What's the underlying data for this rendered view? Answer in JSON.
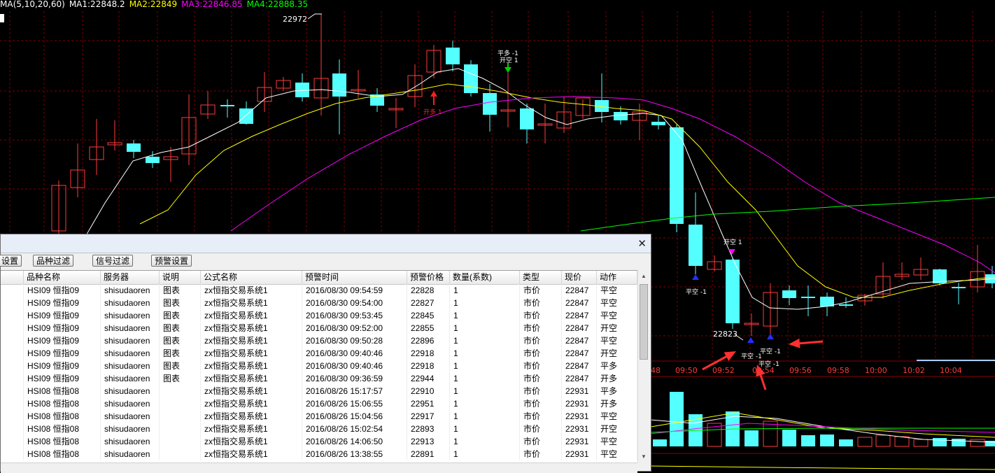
{
  "ma_bar": {
    "label": "MA(5,10,20,60)",
    "ma1": "MA1:22848.2",
    "ma2": "MA2:22849",
    "ma3": "MA3:22846.85",
    "ma4": "MA4:22888.35",
    "colors": {
      "label": "#ffffff",
      "ma1": "#ffffff",
      "ma2": "#ffff00",
      "ma3": "#ff00ff",
      "ma4": "#00ff00"
    }
  },
  "chart_data": {
    "type": "candlestick",
    "high_label": "22972",
    "low_label": "22823",
    "time_labels": [
      "48",
      "09:50",
      "09:52",
      "09:54",
      "09:56",
      "09:58",
      "10:00",
      "10:02",
      "10:04"
    ],
    "signals": [
      {
        "text": "开多 1",
        "color": "#ff2020"
      },
      {
        "text": "平多 -1",
        "color": "#ffffff"
      },
      {
        "text": "开空 1",
        "color": "#ffffff"
      },
      {
        "text": "平空 -1",
        "color": "#ffffff"
      },
      {
        "text": "开空 1",
        "color": "#ffffff"
      },
      {
        "text": "平空 -1",
        "color": "#ffffff"
      },
      {
        "text": "平空 -1",
        "color": "#ffffff"
      },
      {
        "text": "平空 -1",
        "color": "#ffffff"
      }
    ],
    "up_color": "#ff3b3b",
    "down_color": "#54ffff",
    "ma_colors": [
      "#ffffff",
      "#ffff00",
      "#ff00ff",
      "#00ff00"
    ]
  },
  "dialog": {
    "close_icon": "close-icon",
    "toolbar": [
      "设置",
      "品种过滤",
      "信号过滤",
      "预警设置"
    ],
    "columns": [
      "品种名称",
      "服务器",
      "说明",
      "公式名称",
      "预警时间",
      "预警价格",
      "数量(系数)",
      "类型",
      "现价",
      "动作"
    ],
    "rows": [
      [
        "HSI09 恒指09",
        "shisudaoren",
        "图表",
        "zx恒指交易系统1",
        "2016/08/30 09:54:59",
        "22828",
        "1",
        "市价",
        "22847",
        "平空"
      ],
      [
        "HSI09 恒指09",
        "shisudaoren",
        "图表",
        "zx恒指交易系统1",
        "2016/08/30 09:54:00",
        "22827",
        "1",
        "市价",
        "22847",
        "平空"
      ],
      [
        "HSI09 恒指09",
        "shisudaoren",
        "图表",
        "zx恒指交易系统1",
        "2016/08/30 09:53:45",
        "22845",
        "1",
        "市价",
        "22847",
        "平空"
      ],
      [
        "HSI09 恒指09",
        "shisudaoren",
        "图表",
        "zx恒指交易系统1",
        "2016/08/30 09:52:00",
        "22855",
        "1",
        "市价",
        "22847",
        "开空"
      ],
      [
        "HSI09 恒指09",
        "shisudaoren",
        "图表",
        "zx恒指交易系统1",
        "2016/08/30 09:50:28",
        "22896",
        "1",
        "市价",
        "22847",
        "平空"
      ],
      [
        "HSI09 恒指09",
        "shisudaoren",
        "图表",
        "zx恒指交易系统1",
        "2016/08/30 09:40:46",
        "22918",
        "1",
        "市价",
        "22847",
        "开空"
      ],
      [
        "HSI09 恒指09",
        "shisudaoren",
        "图表",
        "zx恒指交易系统1",
        "2016/08/30 09:40:46",
        "22918",
        "1",
        "市价",
        "22847",
        "平多"
      ],
      [
        "HSI09 恒指09",
        "shisudaoren",
        "图表",
        "zx恒指交易系统1",
        "2016/08/30 09:36:59",
        "22944",
        "1",
        "市价",
        "22847",
        "开多"
      ],
      [
        "HSI08 恒指08",
        "shisudaoren",
        "",
        "zx恒指交易系统1",
        "2016/08/26 15:17:57",
        "22910",
        "1",
        "市价",
        "22931",
        "平多"
      ],
      [
        "HSI08 恒指08",
        "shisudaoren",
        "",
        "zx恒指交易系统1",
        "2016/08/26 15:06:55",
        "22951",
        "1",
        "市价",
        "22931",
        "开多"
      ],
      [
        "HSI08 恒指08",
        "shisudaoren",
        "",
        "zx恒指交易系统1",
        "2016/08/26 15:04:56",
        "22917",
        "1",
        "市价",
        "22931",
        "平空"
      ],
      [
        "HSI08 恒指08",
        "shisudaoren",
        "",
        "zx恒指交易系统1",
        "2016/08/26 15:02:54",
        "22893",
        "1",
        "市价",
        "22931",
        "开空"
      ],
      [
        "HSI08 恒指08",
        "shisudaoren",
        "",
        "zx恒指交易系统1",
        "2016/08/26 14:06:50",
        "22913",
        "1",
        "市价",
        "22931",
        "平空"
      ],
      [
        "HSI08 恒指08",
        "shisudaoren",
        "",
        "zx恒指交易系统1",
        "2016/08/26 13:38:55",
        "22891",
        "1",
        "市价",
        "22931",
        "平空"
      ]
    ]
  }
}
